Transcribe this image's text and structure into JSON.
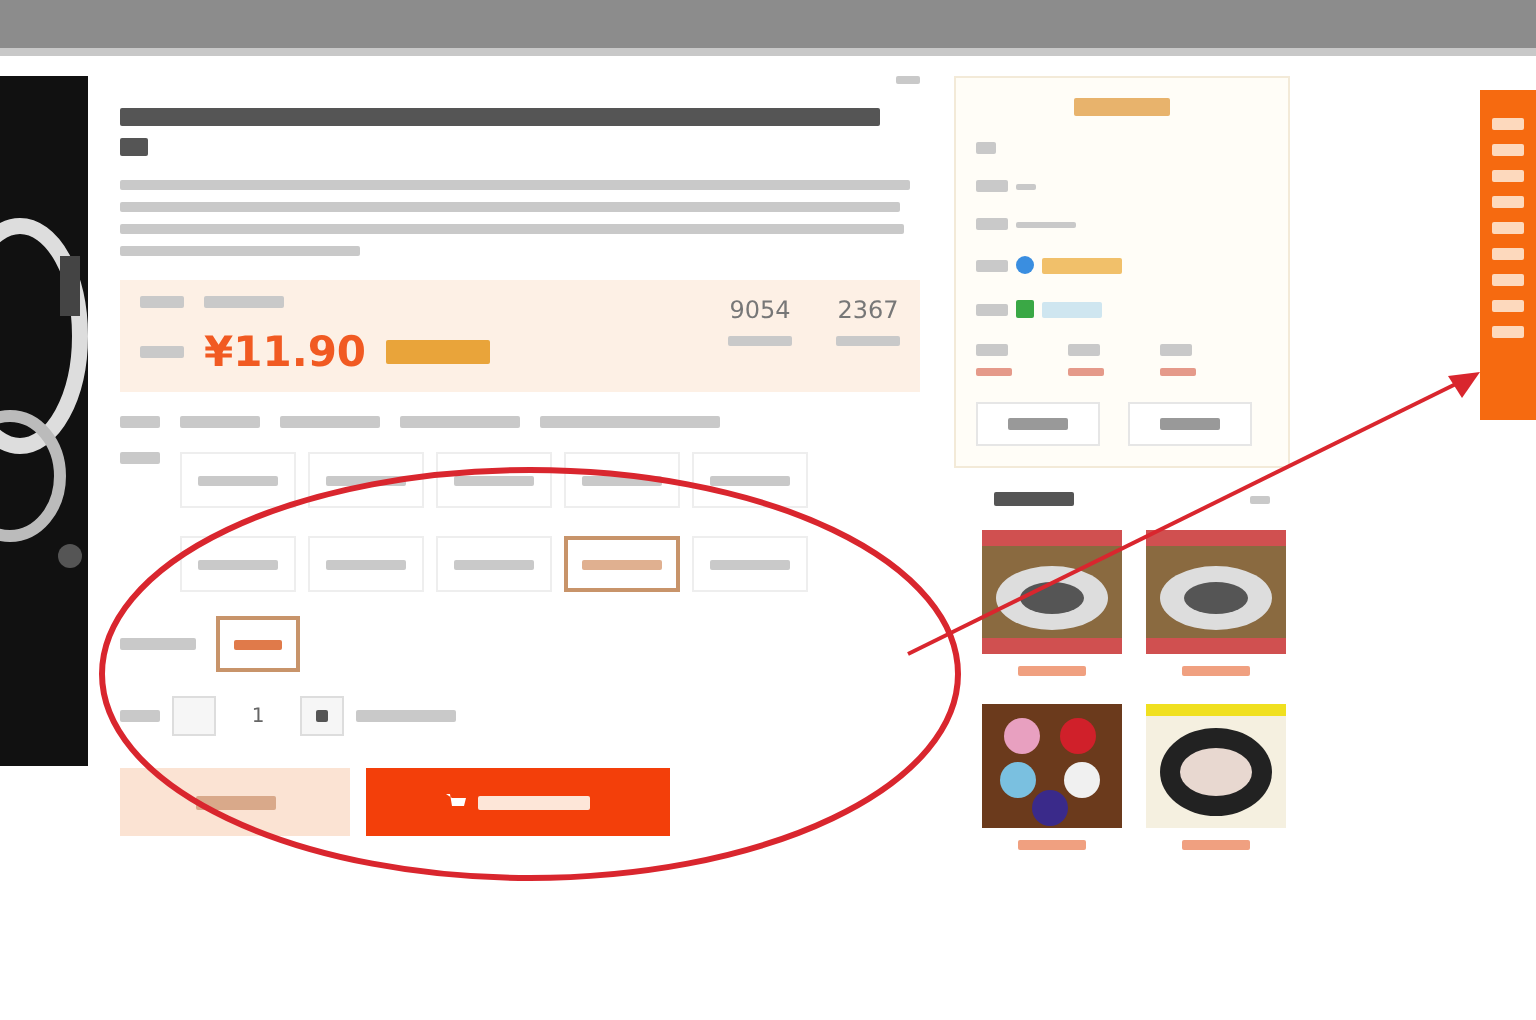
{
  "product": {
    "price": "¥11.90",
    "stats": [
      "9054",
      "2367"
    ],
    "options": [
      {
        "selected": false
      },
      {
        "selected": false
      },
      {
        "selected": false
      },
      {
        "selected": false
      },
      {
        "selected": false
      },
      {
        "selected": false
      },
      {
        "selected": false
      },
      {
        "selected": false
      },
      {
        "selected": true
      },
      {
        "selected": false
      }
    ],
    "colors": [
      {
        "selected": true
      }
    ],
    "quantity": "1"
  }
}
